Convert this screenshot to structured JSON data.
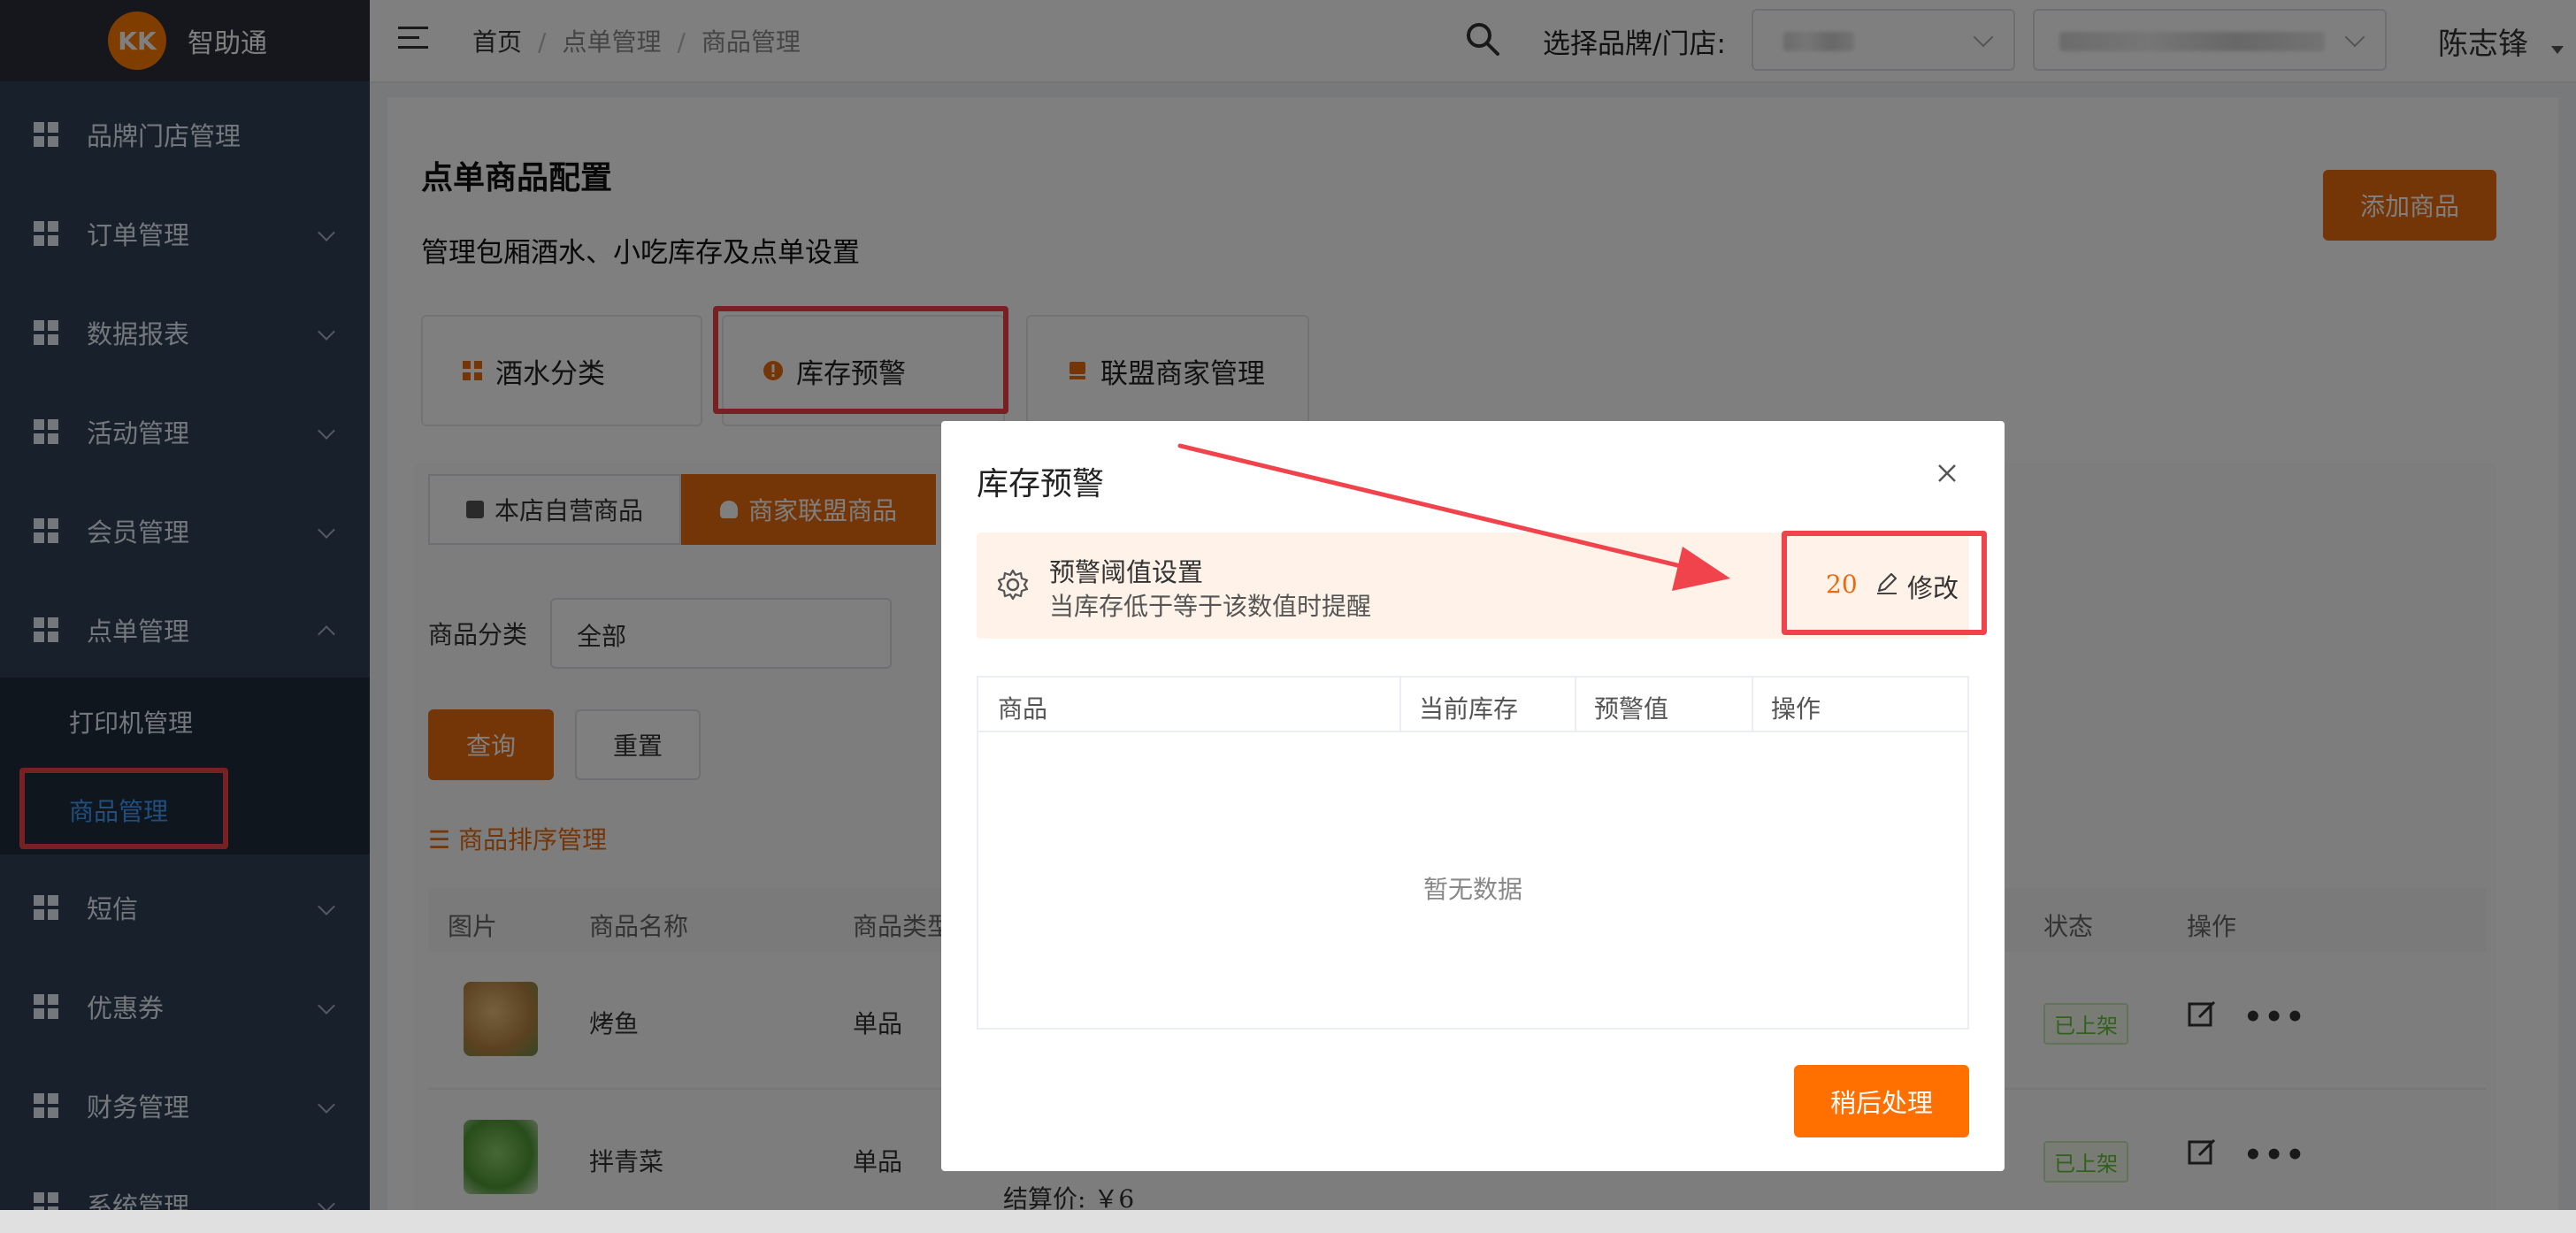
{
  "sidebar": {
    "logo_mark": "KK",
    "app_name": "智助通",
    "items": [
      {
        "label": "品牌门店管理"
      },
      {
        "label": "订单管理"
      },
      {
        "label": "数据报表"
      },
      {
        "label": "活动管理"
      },
      {
        "label": "会员管理"
      },
      {
        "label": "点单管理"
      },
      {
        "label": "短信"
      },
      {
        "label": "优惠券"
      },
      {
        "label": "财务管理"
      },
      {
        "label": "系统管理"
      }
    ],
    "submenu": [
      {
        "label": "打印机管理"
      },
      {
        "label": "商品管理"
      }
    ]
  },
  "header": {
    "breadcrumbs": [
      "首页",
      "点单管理",
      "商品管理"
    ],
    "store_label": "选择品牌/门店:",
    "user_name": "陈志锋"
  },
  "page": {
    "title": "点单商品配置",
    "description": "管理包厢酒水、小吃库存及点单设置",
    "add_button": "添加商品",
    "feature_cards": [
      "酒水分类",
      "库存预警",
      "联盟商家管理"
    ],
    "tabs": [
      "本店自营商品",
      "商家联盟商品"
    ],
    "filter_label": "商品分类",
    "filter_value": "全部",
    "query_button": "查询",
    "reset_button": "重置",
    "sort_link": "商品排序管理",
    "table": {
      "headers": [
        "图片",
        "商品名称",
        "商品类型",
        "状态",
        "操作"
      ],
      "rows": [
        {
          "name": "烤鱼",
          "type": "单品",
          "status": "已上架"
        },
        {
          "name": "拌青菜",
          "type": "单品",
          "status": "已上架"
        }
      ],
      "settle_text": "结算价:  ￥6"
    }
  },
  "modal": {
    "title": "库存预警",
    "alert_title": "预警阈值设置",
    "alert_desc": "当库存低于等于该数值时提醒",
    "threshold": "20",
    "edit_label": "修改",
    "table_headers": [
      "商品",
      "当前库存",
      "预警值",
      "操作"
    ],
    "empty_text": "暂无数据",
    "later_button": "稍后处理"
  },
  "colors": {
    "accent": "#e86c0f",
    "sidebar_bg": "#304156",
    "annotation_red": "#f0434b"
  }
}
